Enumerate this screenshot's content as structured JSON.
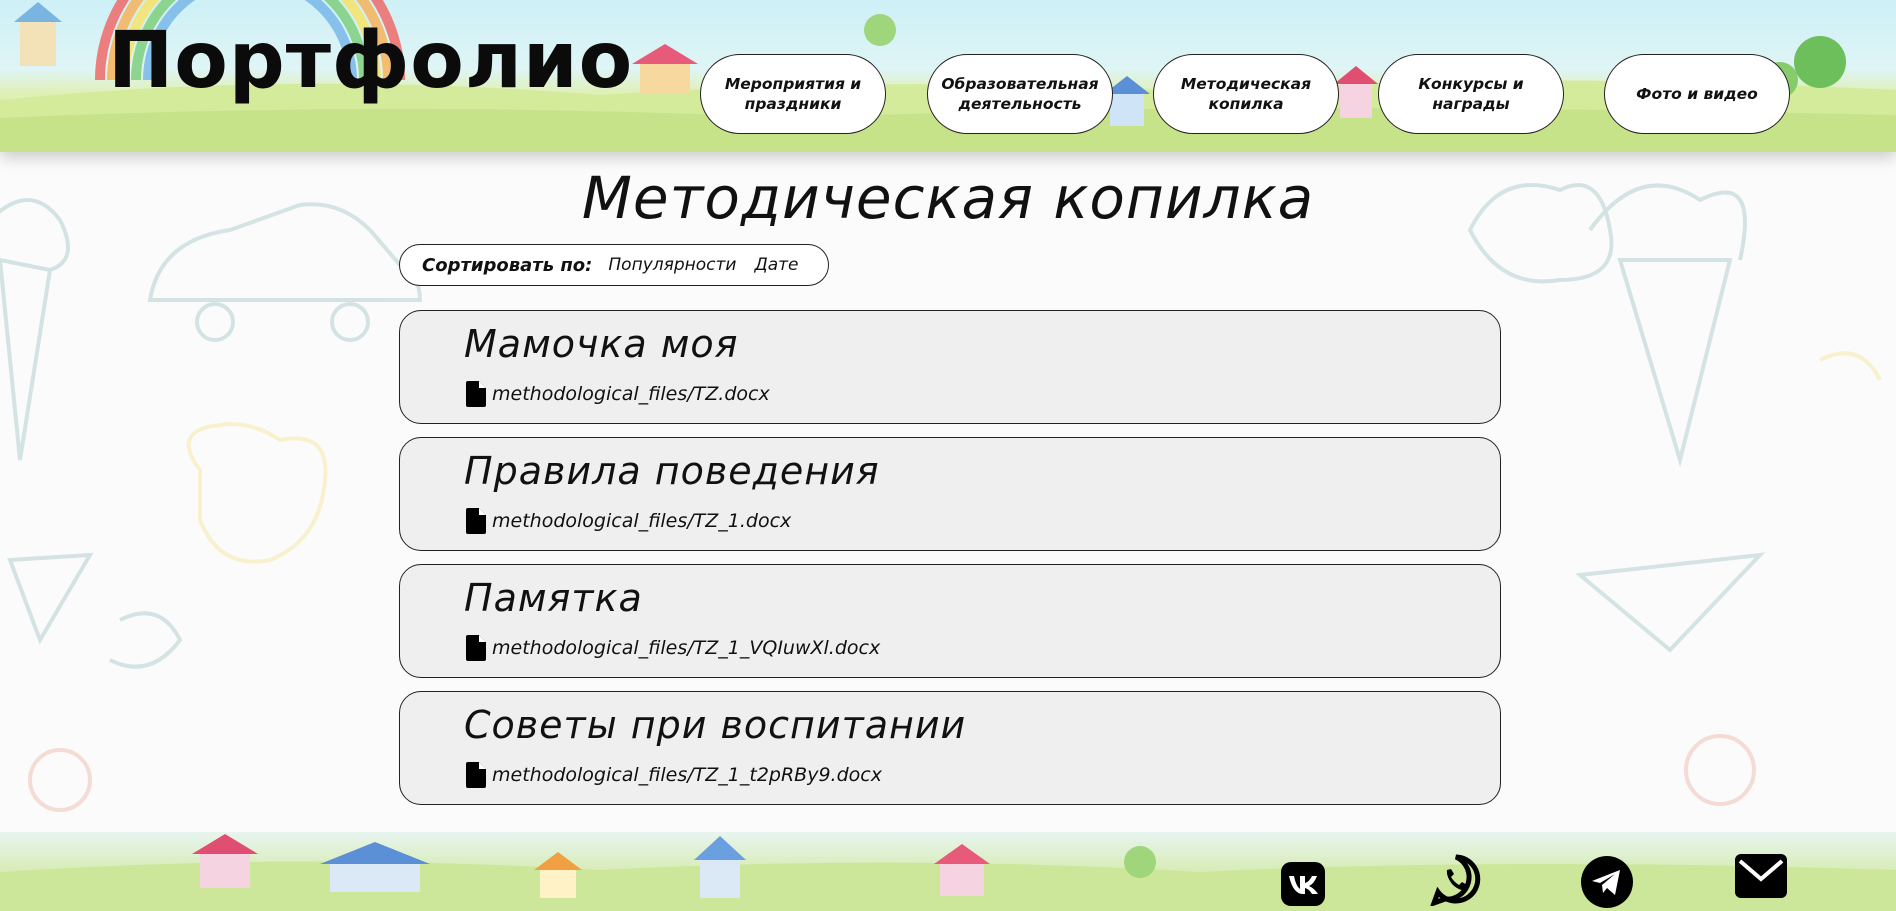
{
  "header": {
    "site_title": "Портфолио",
    "nav": [
      {
        "label": "Мероприятия и праздники"
      },
      {
        "label": "Образовательная деятельность"
      },
      {
        "label": "Методическая копилка"
      },
      {
        "label": "Конкурсы и награды"
      },
      {
        "label": "Фото и видео"
      }
    ]
  },
  "main": {
    "page_title": "Методическая копилка",
    "sort": {
      "label": "Сортировать по:",
      "options": [
        "Популярности",
        "Дате"
      ]
    },
    "items": [
      {
        "title": "Мамочка моя",
        "file": "methodological_files/TZ.docx",
        "icon": "file-icon"
      },
      {
        "title": "Правила поведения",
        "file": "methodological_files/TZ_1.docx",
        "icon": "file-icon"
      },
      {
        "title": "Памятка",
        "file": "methodological_files/TZ_1_VQIuwXl.docx",
        "icon": "file-icon"
      },
      {
        "title": "Советы при воспитании",
        "file": "methodological_files/TZ_1_t2pRBy9.docx",
        "icon": "file-icon"
      }
    ]
  },
  "footer": {
    "social": [
      {
        "icon": "vk-icon"
      },
      {
        "icon": "whatsapp-icon"
      },
      {
        "icon": "telegram-icon"
      },
      {
        "icon": "mail-icon"
      }
    ]
  },
  "colors": {
    "background": "#fbfbfb",
    "card": "#efefef",
    "border": "#222222",
    "header_grass": "#cfe79a",
    "header_sky": "#cdf0f6"
  }
}
